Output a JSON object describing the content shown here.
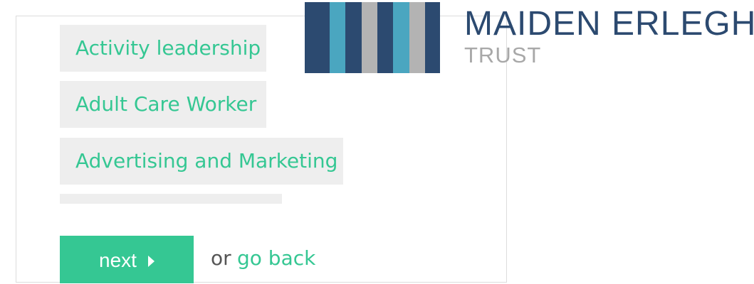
{
  "options": [
    {
      "label": "Activity leadership"
    },
    {
      "label": "Adult Care Worker"
    },
    {
      "label": "Advertising and Marketing"
    }
  ],
  "actions": {
    "next_label": "next",
    "or_text": "or",
    "back_label": "go back"
  },
  "logo": {
    "line1": "MAIDEN ERLEGH",
    "line2": "TRUST",
    "stripes": [
      "#2c4a70",
      "#4aa6c0",
      "#2c4a70",
      "#b3b3b3",
      "#2c4a70",
      "#4aa6c0",
      "#b3b3b3",
      "#2c4a70"
    ]
  },
  "colors": {
    "accent": "#35c793",
    "option_bg": "#eeeeee",
    "brand_navy": "#2c4a70",
    "brand_teal": "#4aa6c0",
    "brand_grey": "#b3b3b3"
  }
}
